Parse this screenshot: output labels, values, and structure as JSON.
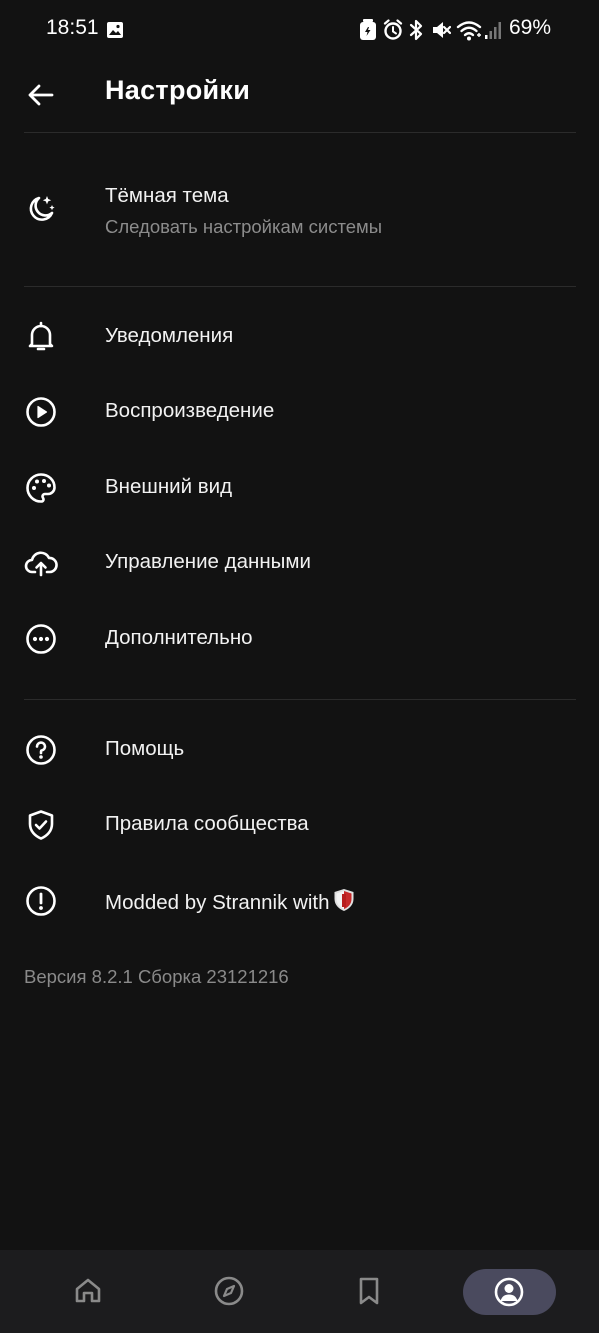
{
  "status_bar": {
    "time": "18:51",
    "battery": "69%"
  },
  "header": {
    "title": "Настройки",
    "back_icon": "arrow-left-icon"
  },
  "theme": {
    "title": "Тёмная тема",
    "subtitle": "Следовать настройкам системы",
    "icon": "moon-stars-icon"
  },
  "items": [
    {
      "label": "Уведомления",
      "icon": "bell-icon"
    },
    {
      "label": "Воспроизведение",
      "icon": "play-circle-icon"
    },
    {
      "label": "Внешний вид",
      "icon": "palette-icon"
    },
    {
      "label": "Управление данными",
      "icon": "cloud-upload-icon"
    },
    {
      "label": "Дополнительно",
      "icon": "more-circle-icon"
    },
    {
      "label": "Помощь",
      "icon": "help-circle-icon"
    },
    {
      "label": "Правила сообщества",
      "icon": "shield-check-icon"
    },
    {
      "label": "Modded by Strannik with",
      "icon": "alert-circle-icon"
    }
  ],
  "version": "Версия 8.2.1 Сборка 23121216",
  "bottom_nav": [
    {
      "icon": "home-icon",
      "active": false
    },
    {
      "icon": "compass-icon",
      "active": false
    },
    {
      "icon": "bookmark-icon",
      "active": false
    },
    {
      "icon": "profile-icon",
      "active": true
    }
  ],
  "colors": {
    "background": "#121212",
    "text": "#ffffff",
    "secondary_text": "#8c8c8c",
    "nav_background": "#1c1c1e",
    "active_pill": "#4a4a5e"
  }
}
